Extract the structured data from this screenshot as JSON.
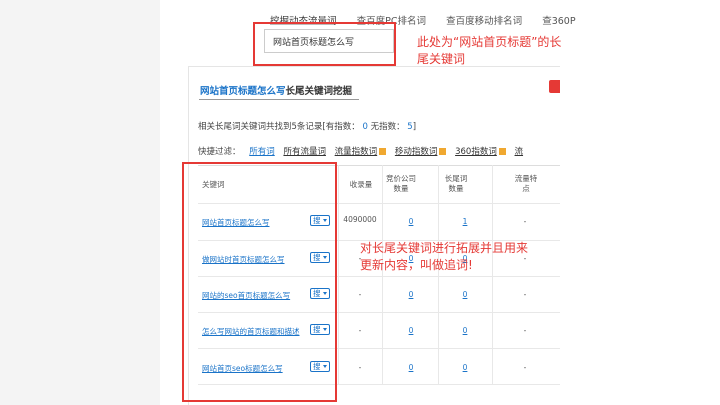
{
  "top_nav": {
    "links": [
      "挖掘动态流量词",
      "查百度PC排名词",
      "查百度移动排名词",
      "查360P"
    ]
  },
  "search": {
    "keyword": "网站首页标题怎么写"
  },
  "annotations": {
    "search_note": "此处为“网站首页标题”的长尾关键词",
    "table_note": "对长尾关键词进行拓展并且用来更新内容，叫做追词!"
  },
  "panel": {
    "title_keyword": "网站首页标题怎么写",
    "title_suffix": "长尾关键词挖掘",
    "summary_prefix": "相关长尾词关键词共找到5条记录[有指数：",
    "summary_index_count": "0",
    "summary_mid": "无指数：",
    "summary_noindex_count": "5",
    "summary_suffix": "]",
    "filter_label": "快捷过滤：",
    "filters": [
      "所有词",
      "所有流量词",
      "流量指数词",
      "移动指数词",
      "360指数词",
      "流"
    ]
  },
  "table": {
    "headers": {
      "keyword": "关键词",
      "volume": "收录量",
      "bid_companies": "竞价公司数量",
      "longtail": "长尾词数量",
      "traffic": "流量特点"
    },
    "search_label": "搜",
    "rows": [
      {
        "keyword": "网站首页标题怎么写",
        "volume": "4090000",
        "bid": "0",
        "longtail": "1",
        "traffic": "-"
      },
      {
        "keyword": "做网站时首页标题怎么写",
        "volume": "-",
        "bid": "0",
        "longtail": "0",
        "traffic": "-"
      },
      {
        "keyword": "网站的seo首页标题怎么写",
        "volume": "-",
        "bid": "0",
        "longtail": "0",
        "traffic": "-"
      },
      {
        "keyword": "怎么写网站的首页标题和描述",
        "volume": "-",
        "bid": "0",
        "longtail": "0",
        "traffic": "-"
      },
      {
        "keyword": "网站首页seo标题怎么写",
        "volume": "-",
        "bid": "0",
        "longtail": "0",
        "traffic": "-"
      }
    ]
  },
  "colors": {
    "accent": "#1a73c8",
    "annotation": "#e53935"
  }
}
